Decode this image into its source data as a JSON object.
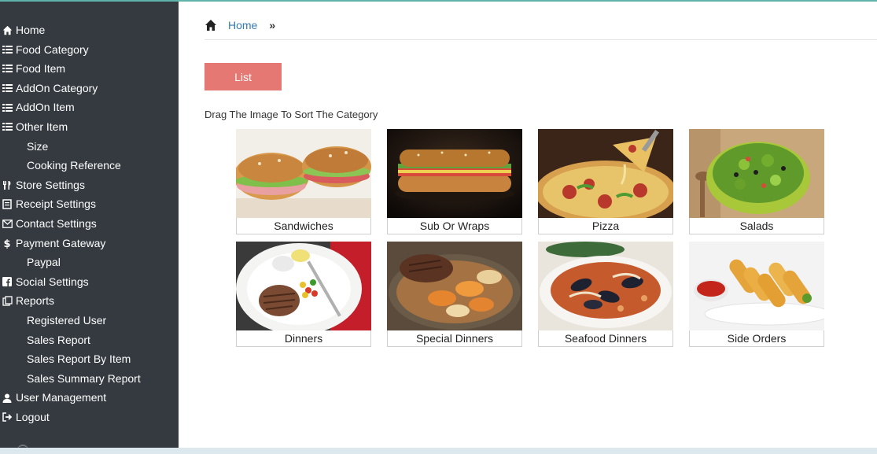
{
  "sidebar": {
    "items": [
      {
        "label": "Home",
        "icon": "home-icon",
        "sub": false
      },
      {
        "label": "Food Category",
        "icon": "list-icon",
        "sub": false
      },
      {
        "label": "Food Item",
        "icon": "list-icon",
        "sub": false
      },
      {
        "label": "AddOn Category",
        "icon": "list-icon",
        "sub": false
      },
      {
        "label": "AddOn Item",
        "icon": "list-icon",
        "sub": false
      },
      {
        "label": "Other Item",
        "icon": "list-icon",
        "sub": false
      },
      {
        "label": "Size",
        "icon": "",
        "sub": true
      },
      {
        "label": "Cooking Reference",
        "icon": "",
        "sub": true
      },
      {
        "label": "Store Settings",
        "icon": "cutlery-icon",
        "sub": false
      },
      {
        "label": "Receipt Settings",
        "icon": "receipt-icon",
        "sub": false
      },
      {
        "label": "Contact Settings",
        "icon": "envelope-icon",
        "sub": false
      },
      {
        "label": "Payment Gateway",
        "icon": "dollar-icon",
        "sub": false
      },
      {
        "label": "Paypal",
        "icon": "",
        "sub": true
      },
      {
        "label": "Social Settings",
        "icon": "facebook-icon",
        "sub": false
      },
      {
        "label": "Reports",
        "icon": "reports-icon",
        "sub": false
      },
      {
        "label": "Registered User",
        "icon": "",
        "sub": true
      },
      {
        "label": "Sales Report",
        "icon": "",
        "sub": true
      },
      {
        "label": "Sales Report By Item",
        "icon": "",
        "sub": true
      },
      {
        "label": "Sales Summary Report",
        "icon": "",
        "sub": true
      },
      {
        "label": "User Management",
        "icon": "user-icon",
        "sub": false
      },
      {
        "label": "Logout",
        "icon": "logout-icon",
        "sub": false
      }
    ]
  },
  "breadcrumb": {
    "home_label": "Home",
    "separator": "»"
  },
  "toolbar": {
    "list_label": "List"
  },
  "hint": "Drag The Image To Sort The Category",
  "categories": [
    {
      "label": "Sandwiches",
      "image": "sandwiches-photo"
    },
    {
      "label": "Sub Or Wraps",
      "image": "sub-wrap-photo"
    },
    {
      "label": "Pizza",
      "image": "pizza-photo"
    },
    {
      "label": "Salads",
      "image": "salad-photo"
    },
    {
      "label": "Dinners",
      "image": "dinner-photo"
    },
    {
      "label": "Special Dinners",
      "image": "special-dinner-photo"
    },
    {
      "label": "Seafood Dinners",
      "image": "seafood-photo"
    },
    {
      "label": "Side Orders",
      "image": "side-orders-photo"
    }
  ],
  "colors": {
    "sidebar_bg": "#343a40",
    "list_button": "#e67873",
    "link": "#337ab7",
    "top_accent": "#5fb3a9"
  }
}
